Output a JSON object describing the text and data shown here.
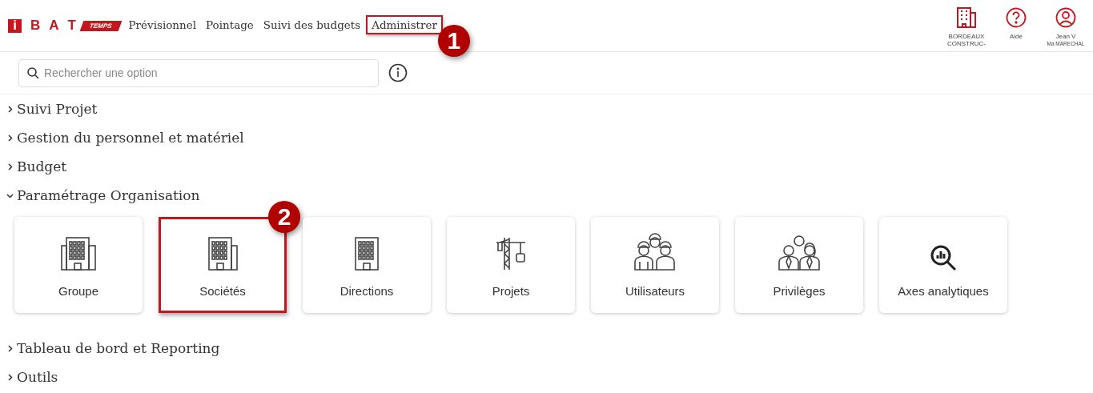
{
  "logo": {
    "letters": [
      "i",
      "B",
      "A",
      "T"
    ],
    "tag": "TEMPS"
  },
  "nav": [
    {
      "label": "Prévisionnel",
      "highlighted": false
    },
    {
      "label": "Pointage",
      "highlighted": false
    },
    {
      "label": "Suivi des budgets",
      "highlighted": false
    },
    {
      "label": "Administrer",
      "highlighted": true,
      "callout": "1"
    }
  ],
  "header_actions": [
    {
      "kind": "company",
      "label": "BORDEAUX CONSTRUC-"
    },
    {
      "kind": "help",
      "label": "Aide"
    },
    {
      "kind": "user",
      "label": "Jean V",
      "sublabel": "Ma MARECHAL"
    }
  ],
  "search": {
    "placeholder": "Rechercher une option"
  },
  "sections": [
    {
      "label": "Suivi Projet",
      "expanded": false
    },
    {
      "label": "Gestion du personnel et matériel",
      "expanded": false
    },
    {
      "label": "Budget",
      "expanded": false
    },
    {
      "label": "Paramétrage Organisation",
      "expanded": true,
      "tiles": [
        {
          "label": "Groupe",
          "kind": "buildings",
          "highlighted": false
        },
        {
          "label": "Sociétés",
          "kind": "building-wing",
          "highlighted": true,
          "callout": "2"
        },
        {
          "label": "Directions",
          "kind": "building",
          "highlighted": false
        },
        {
          "label": "Projets",
          "kind": "crane",
          "highlighted": false
        },
        {
          "label": "Utilisateurs",
          "kind": "workers",
          "highlighted": false
        },
        {
          "label": "Privilèges",
          "kind": "people",
          "highlighted": false
        },
        {
          "label": "Axes analytiques",
          "kind": "analytics",
          "highlighted": false
        }
      ]
    },
    {
      "label": "Tableau de bord et Reporting",
      "expanded": false
    },
    {
      "label": "Outils",
      "expanded": false
    }
  ]
}
